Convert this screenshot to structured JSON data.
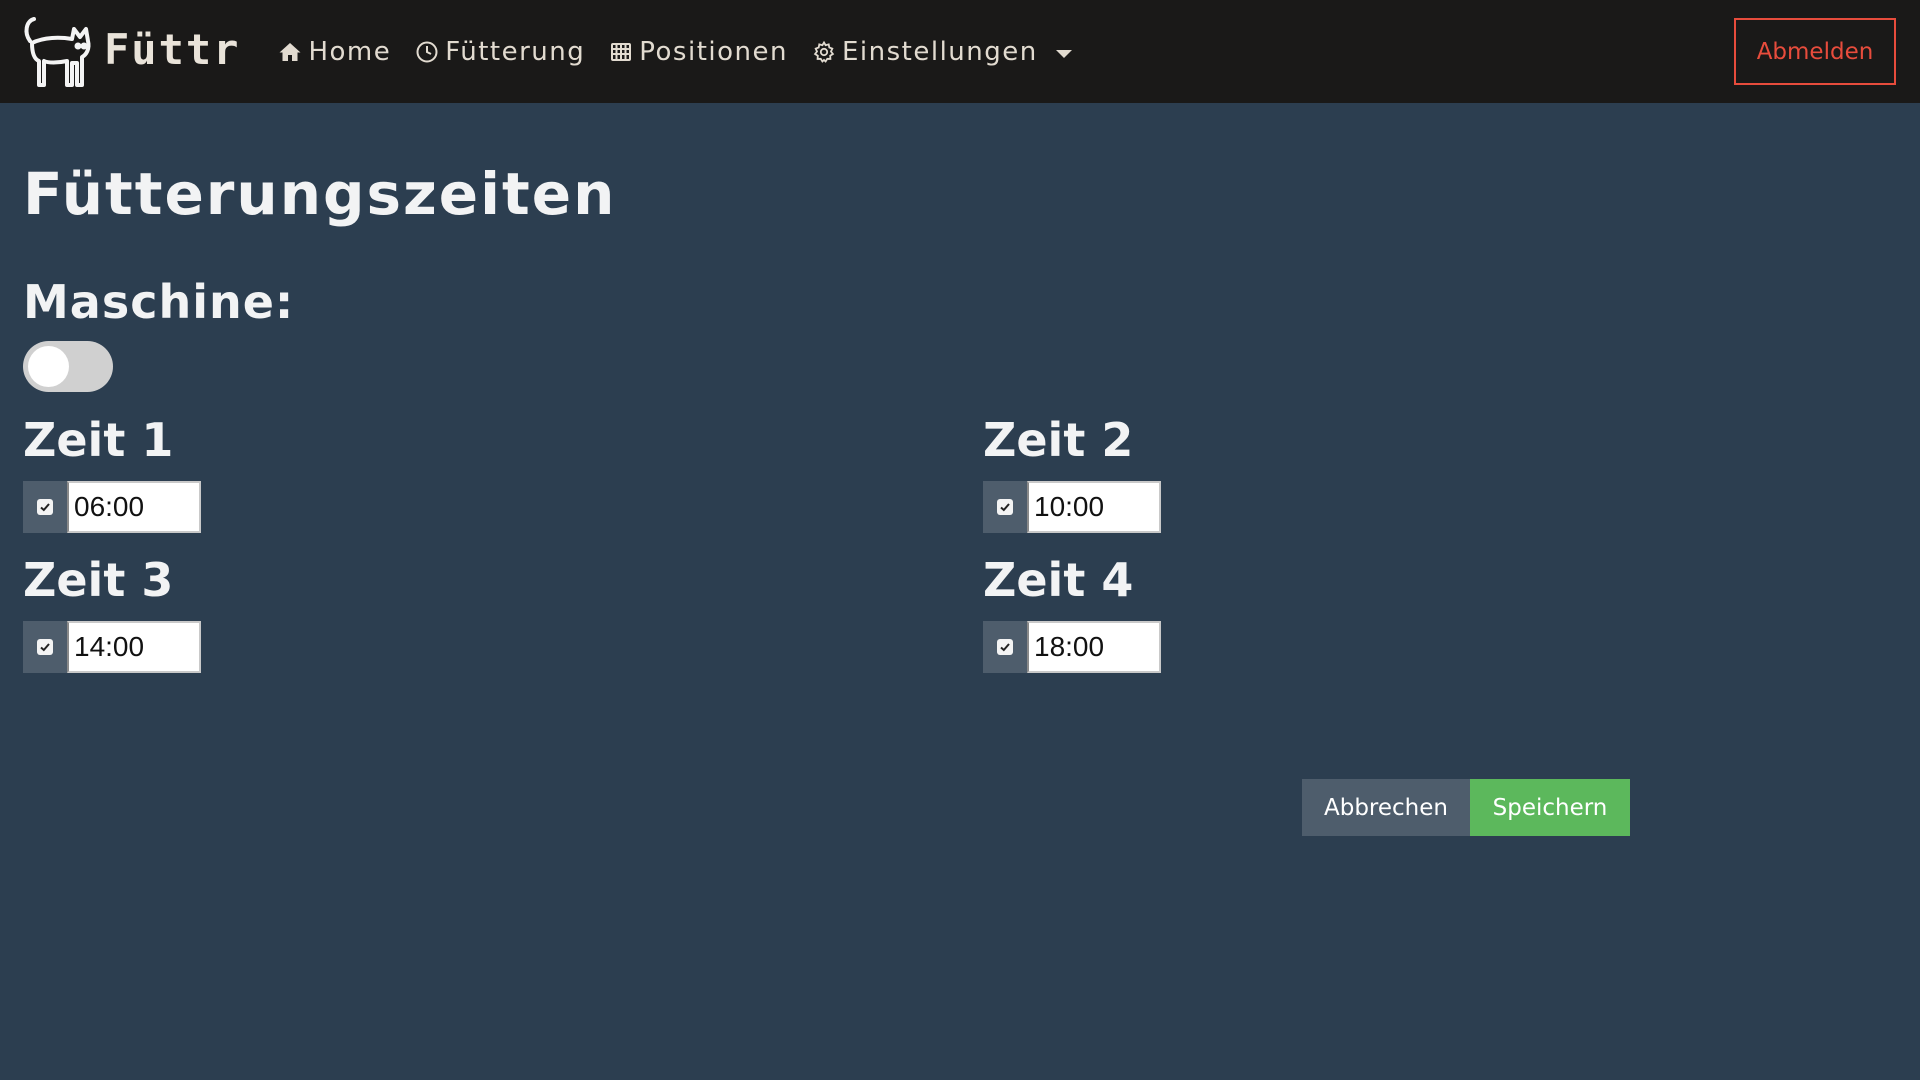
{
  "navbar": {
    "brand": "Füttr",
    "items": [
      {
        "label": "Home",
        "icon": "home-icon"
      },
      {
        "label": "Fütterung",
        "icon": "clock-icon"
      },
      {
        "label": "Positionen",
        "icon": "grid-icon"
      },
      {
        "label": "Einstellungen",
        "icon": "gear-icon"
      }
    ],
    "logout_label": "Abmelden"
  },
  "main": {
    "title": "Fütterungszeiten",
    "machine_label": "Maschine:",
    "machine_enabled": false,
    "times": [
      {
        "label": "Zeit 1",
        "value": "06:00",
        "enabled": true
      },
      {
        "label": "Zeit 2",
        "value": "10:00",
        "enabled": true
      },
      {
        "label": "Zeit 3",
        "value": "14:00",
        "enabled": true
      },
      {
        "label": "Zeit 4",
        "value": "18:00",
        "enabled": true
      }
    ],
    "cancel_label": "Abbrechen",
    "save_label": "Speichern"
  },
  "colors": {
    "background": "#2c3e50",
    "navbar": "#1a1918",
    "logout": "#e74c3c",
    "save": "#5cb85c",
    "cancel": "#4e5d6c"
  }
}
